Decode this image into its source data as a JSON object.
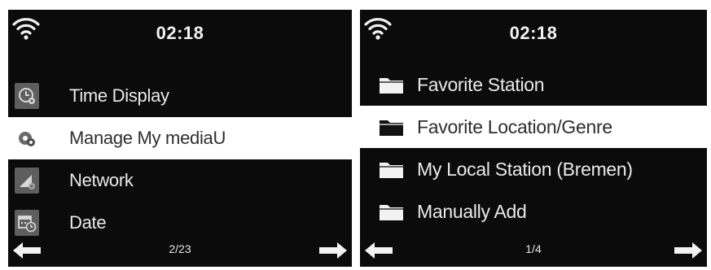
{
  "left_screen": {
    "status": {
      "time": "02:18",
      "wifi_icon": "wifi-icon"
    },
    "menu_items": [
      {
        "label": "Time Display",
        "icon": "clock-settings-icon",
        "selected": false
      },
      {
        "label": "Manage My mediaU",
        "icon": "media-gear-icon",
        "selected": true
      },
      {
        "label": "Network",
        "icon": "signal-gear-icon",
        "selected": false
      },
      {
        "label": "Date",
        "icon": "calendar-clock-icon",
        "selected": false
      }
    ],
    "footer": {
      "page": "2/23",
      "prev_icon": "arrow-left-icon",
      "next_icon": "arrow-right-icon"
    }
  },
  "right_screen": {
    "status": {
      "time": "02:18",
      "wifi_icon": "wifi-icon"
    },
    "menu_items": [
      {
        "label": "Favorite Station",
        "icon": "folder-icon",
        "selected": false
      },
      {
        "label": "Favorite Location/Genre",
        "icon": "folder-icon",
        "selected": true
      },
      {
        "label": "My Local Station (Bremen)",
        "icon": "folder-icon",
        "selected": false
      },
      {
        "label": "Manually Add",
        "icon": "folder-icon",
        "selected": false
      }
    ],
    "footer": {
      "page": "1/4",
      "prev_icon": "arrow-left-icon",
      "next_icon": "arrow-right-icon"
    }
  },
  "colors": {
    "screen_background": "#0b0b0b",
    "text": "#e9e9e9",
    "selected_background": "#ffffff",
    "selected_text": "#2e2e2e",
    "icon_box": "#5e5e5e"
  }
}
